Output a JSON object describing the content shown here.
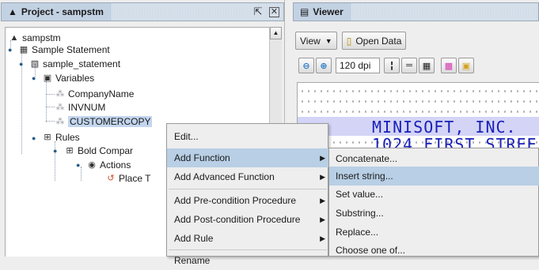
{
  "project_panel": {
    "title": "Project - sampstm",
    "title_icon": "project-icon",
    "restore_glyph": "restore-icon",
    "close_glyph": "close-icon"
  },
  "tree": {
    "root": "sampstm",
    "statement": "Sample Statement",
    "sample_statement": "sample_statement",
    "variables": "Variables",
    "var_company": "CompanyName",
    "var_invnum": "INVNUM",
    "var_customer": "CUSTOMERCOPY",
    "rules": "Rules",
    "bold_company": "Bold Compar",
    "actions": "Actions",
    "place": "Place T"
  },
  "viewer": {
    "title": "Viewer",
    "view_label": "View",
    "open_data_label": "Open Data",
    "dpi_value": "120 dpi",
    "preview_line1": "MINISOFT, INC.",
    "preview_line2": "1024 FIRST STREE"
  },
  "context_menu": {
    "items": [
      "Edit...",
      "Add Function",
      "Add Advanced Function",
      "Add Pre-condition Procedure",
      "Add Post-condition Procedure",
      "Add Rule",
      "Rename"
    ]
  },
  "sub_menu": {
    "items": [
      "Concatenate...",
      "Insert string...",
      "Set value...",
      "Substring...",
      "Replace...",
      "Choose one of..."
    ]
  },
  "colors": {
    "menu_highlight": "#b8cfe5",
    "preview_text": "#1a21b8",
    "title_bar": "#c3d2e3"
  }
}
